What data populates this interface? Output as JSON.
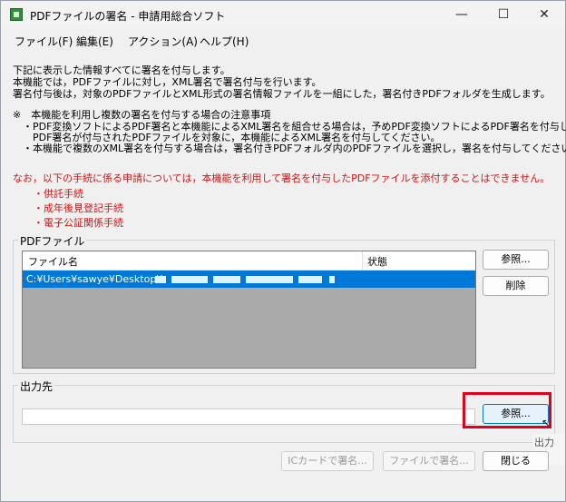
{
  "window": {
    "title": "PDFファイルの署名 - 申請用総合ソフト",
    "minimize": "—",
    "maximize": "☐",
    "close": "✕"
  },
  "menu": [
    "ファイル(F)",
    "編集(E)",
    "アクション(A)",
    "ヘルプ(H)"
  ],
  "intro": [
    "下記に表示した情報すべてに署名を付与します。",
    "本機能では，PDFファイルに対し，XML署名で署名付与を行います。",
    "署名付与後は，対象のPDFファイルとXML形式の署名情報ファイルを一組にした，署名付きPDFフォルダを生成します。"
  ],
  "notes": [
    "※　本機能を利用し複数の署名を付与する場合の注意事項",
    "・PDF変換ソフトによるPDF署名と本機能によるXML署名を組合せる場合は，予めPDF変換ソフトによるPDF署名を付与し，",
    "　PDF署名が付与されたPDFファイルを対象に，本機能によるXML署名を付与してください。",
    "・本機能で複数のXML署名を付与する場合は，署名付きPDFフォルダ内のPDFファイルを選択し，署名を付与してください。"
  ],
  "warning": "なお，以下の手続に係る申請については，本機能を利用して署名を付与したPDFファイルを添付することはできません。",
  "procedures": [
    "・供託手続",
    "・成年後見登記手続",
    "・電子公証関係手続"
  ],
  "pdf_section": {
    "label": "PDFファイル",
    "columns": [
      "ファイル名",
      "状態"
    ],
    "rows": [
      {
        "file": "C:¥Users¥sawye¥Desktop¥",
        "status": ""
      }
    ],
    "browse": "参照...",
    "delete": "削除"
  },
  "output_section": {
    "label": "出力先",
    "path": "",
    "browse": "参照...",
    "tooltip": "出力先"
  },
  "footer": {
    "ic_card_sign": "ICカードで署名...",
    "file_sign": "ファイルで署名...",
    "close": "閉じる"
  }
}
